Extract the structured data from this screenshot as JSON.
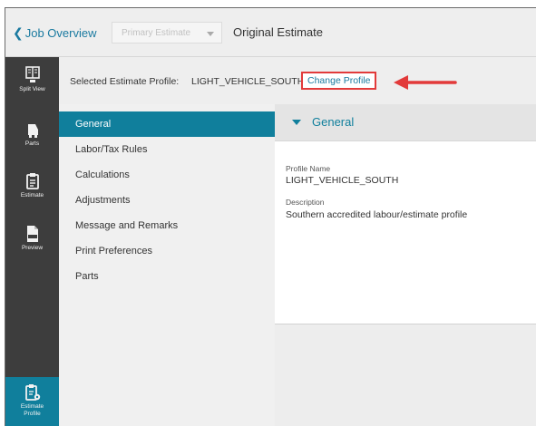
{
  "header": {
    "back_label": "Job Overview",
    "estimate_select": {
      "value": "Primary Estimate"
    },
    "title": "Original Estimate"
  },
  "rail": {
    "items": [
      {
        "label": "Split View",
        "icon": "split-view-icon"
      },
      {
        "label": "Parts",
        "icon": "parts-icon"
      },
      {
        "label": "Estimate",
        "icon": "estimate-icon"
      },
      {
        "label": "Preview",
        "icon": "pdf-preview-icon"
      },
      {
        "label": "Estimate Profile",
        "icon": "estimate-profile-icon",
        "active": true
      }
    ]
  },
  "profile": {
    "label": "Selected Estimate Profile:",
    "value": "LIGHT_VEHICLE_SOUTH",
    "change_label": "Change Profile"
  },
  "nav": {
    "items": [
      {
        "label": "General",
        "active": true
      },
      {
        "label": "Labor/Tax Rules"
      },
      {
        "label": "Calculations"
      },
      {
        "label": "Adjustments"
      },
      {
        "label": "Message and Remarks"
      },
      {
        "label": "Print Preferences"
      },
      {
        "label": "Parts"
      }
    ]
  },
  "pane": {
    "title": "General",
    "fields": [
      {
        "label": "Profile Name",
        "value": "LIGHT_VEHICLE_SOUTH"
      },
      {
        "label": "Description",
        "value": "Southern accredited labour/estimate profile"
      }
    ]
  },
  "colors": {
    "accent": "#107f9c",
    "rail": "#3d3d3d",
    "highlight": "#e23a3a"
  }
}
